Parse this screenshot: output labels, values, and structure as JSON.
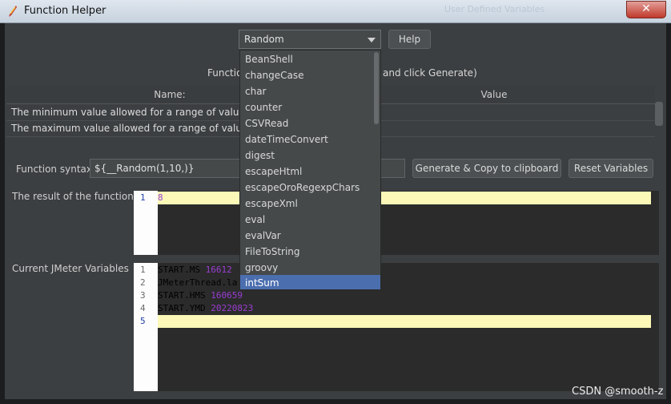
{
  "window": {
    "title": "Function Helper",
    "ghost_title": "User Defined Variables",
    "close_glyph": "✕"
  },
  "header": {
    "selected_function": "Random",
    "help_label": "Help",
    "instruction_left": "Functio",
    "instruction_right": "and click Generate)"
  },
  "params_table": {
    "columns": [
      "Name:",
      "Value"
    ],
    "rows": [
      {
        "name": "The minimum value allowed for a range of values",
        "value": ""
      },
      {
        "name": "The maximum value allowed for a range of values",
        "value": ""
      }
    ]
  },
  "syntax": {
    "label": "Function syntax:",
    "value": "${__Random(1,10,)}",
    "generate_label": "Generate & Copy to clipboard",
    "reset_label": "Reset Variables"
  },
  "result": {
    "label": "The result of the function is",
    "lines": [
      {
        "n": "1",
        "text": "8"
      }
    ]
  },
  "variables": {
    "label": "Current JMeter Variables",
    "lines": [
      {
        "n": "1",
        "key": "START.MS",
        "val": "16612"
      },
      {
        "n": "2",
        "key": "JMeterThread.la",
        "val": ""
      },
      {
        "n": "3",
        "key": "START.HMS",
        "val": "160659"
      },
      {
        "n": "4",
        "key": "START.YMD",
        "val": "20220823"
      },
      {
        "n": "5",
        "key": "",
        "val": ""
      }
    ]
  },
  "dropdown": {
    "items": [
      "BeanShell",
      "changeCase",
      "char",
      "counter",
      "CSVRead",
      "dateTimeConvert",
      "digest",
      "escapeHtml",
      "escapeOroRegexpChars",
      "escapeXml",
      "eval",
      "evalVar",
      "FileToString",
      "groovy",
      "intSum"
    ],
    "selected": "intSum"
  },
  "watermark": "CSDN @smooth-z"
}
